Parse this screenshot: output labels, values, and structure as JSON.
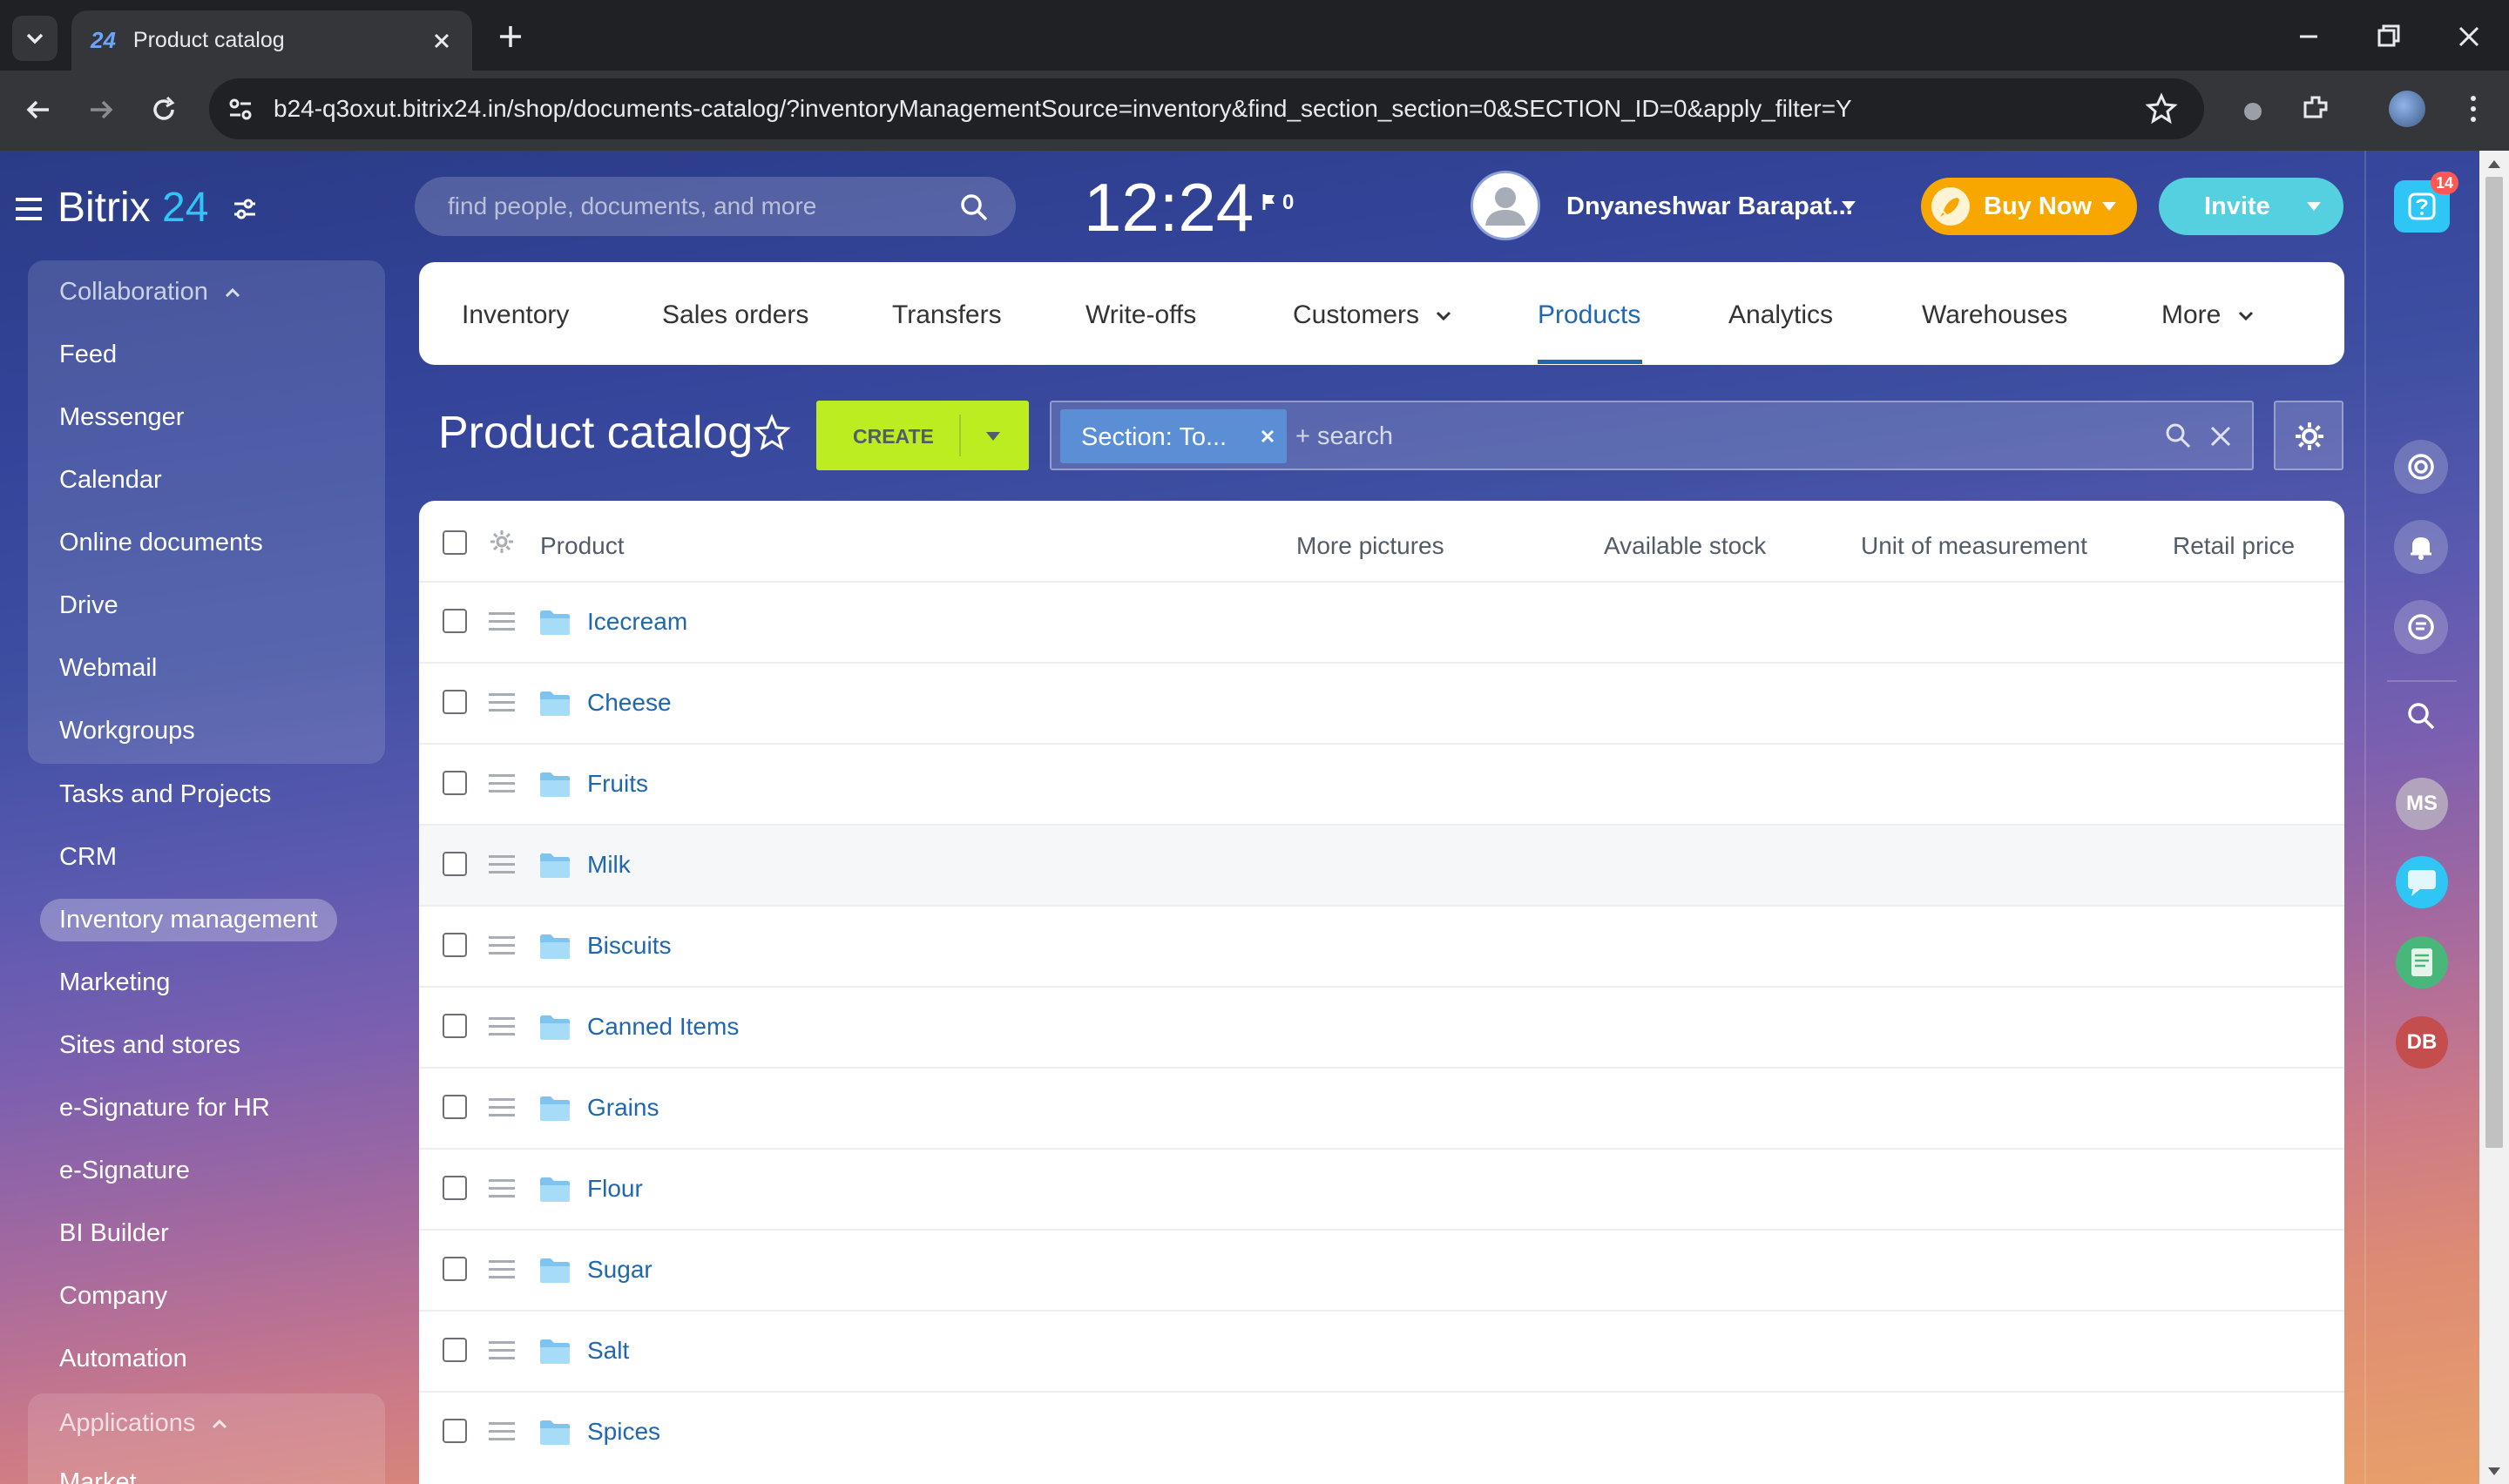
{
  "browser": {
    "tab_title": "Product catalog",
    "tab_logo": "24",
    "url": "b24-q3oxut.bitrix24.in/shop/documents-catalog/?inventoryManagementSource=inventory&find_section_section=0&SECTION_ID=0&apply_filter=Y"
  },
  "header": {
    "logo_main": "Bitrix",
    "logo_num": "24",
    "search_placeholder": "find people, documents, and more",
    "clock": "12:24",
    "flag_count": "0",
    "user_name": "Dnyaneshwar Barapat...",
    "buy_now": "Buy Now",
    "invite": "Invite"
  },
  "sidebar": {
    "group1": "Collaboration",
    "group1_items": [
      "Feed",
      "Messenger",
      "Calendar",
      "Online documents",
      "Drive",
      "Webmail",
      "Workgroups"
    ],
    "items": [
      "Tasks and Projects",
      "CRM",
      "Inventory management",
      "Marketing",
      "Sites and stores",
      "e-Signature for HR",
      "e-Signature",
      "BI Builder",
      "Company",
      "Automation"
    ],
    "group2": "Applications",
    "group2_first": "Market"
  },
  "nav": {
    "items": [
      "Inventory",
      "Sales orders",
      "Transfers",
      "Write-offs",
      "Customers",
      "Products",
      "Analytics",
      "Warehouses",
      "More"
    ],
    "active": "Products"
  },
  "page": {
    "title": "Product catalog",
    "create": "CREATE",
    "filter_tag": "Section: To...",
    "search_placeholder": "+ search"
  },
  "table": {
    "headers": [
      "Product",
      "More pictures",
      "Available stock",
      "Unit of measurement",
      "Retail price"
    ],
    "rows": [
      "Icecream",
      "Cheese",
      "Fruits",
      "Milk",
      "Biscuits",
      "Canned Items",
      "Grains",
      "Flour",
      "Sugar",
      "Salt",
      "Spices"
    ]
  },
  "right_panel": {
    "help_badge": "14",
    "avatars": [
      "MS",
      "DB"
    ]
  },
  "colors": {
    "accent_blue": "#2067b0",
    "create_green": "#bbed21",
    "buy_now_orange": "#f7a700",
    "invite_blue": "#55d0e0"
  }
}
